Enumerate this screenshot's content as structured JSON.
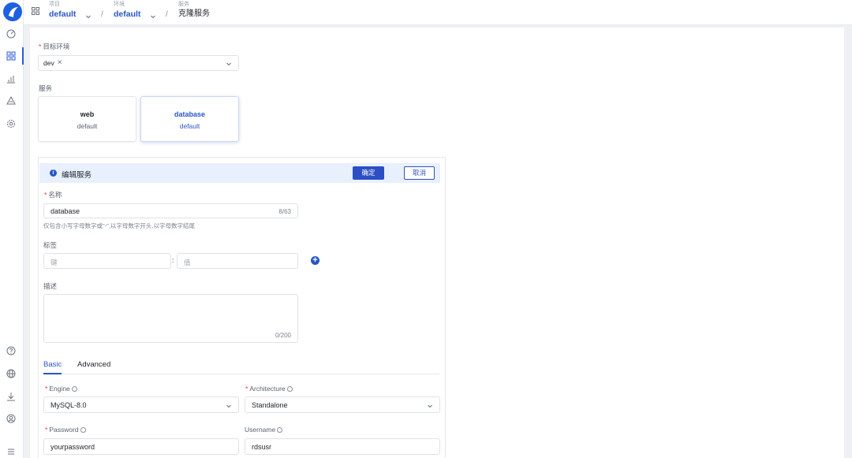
{
  "breadcrumb": [
    {
      "label": "项目",
      "value": "default"
    },
    {
      "label": "环境",
      "value": "default"
    },
    {
      "label": "服务",
      "value": "克隆服务"
    }
  ],
  "target_env": {
    "label": "目标环境",
    "tag": "dev"
  },
  "services": {
    "label": "服务",
    "items": [
      {
        "name": "web",
        "namespace": "default",
        "active": false
      },
      {
        "name": "database",
        "namespace": "default",
        "active": true
      }
    ]
  },
  "edit": {
    "title": "编辑服务",
    "confirm_label": "确定",
    "cancel_label": "取消",
    "name": {
      "label": "名称",
      "value": "database",
      "counter": "8/63",
      "hint": "仅包含小写字母数字或\"-\",以字母数字开头,以字母数字结尾"
    },
    "tags": {
      "label": "标签",
      "key_placeholder": "键",
      "separator": ":",
      "value_placeholder": "值"
    },
    "desc": {
      "label": "描述",
      "counter": "0/200"
    },
    "tabs": [
      {
        "label": "Basic"
      },
      {
        "label": "Advanced"
      }
    ],
    "engine": {
      "label": "Engine",
      "value": "MySQL-8.0"
    },
    "architecture": {
      "label": "Architecture",
      "value": "Standalone"
    },
    "password": {
      "label": "Password",
      "value": "yourpassword"
    },
    "username": {
      "label": "Username",
      "value": "rdsusr"
    }
  },
  "colors": {
    "accent": "#2d4fc4",
    "required": "#e0353a",
    "header_bg": "#e8f0fd"
  }
}
